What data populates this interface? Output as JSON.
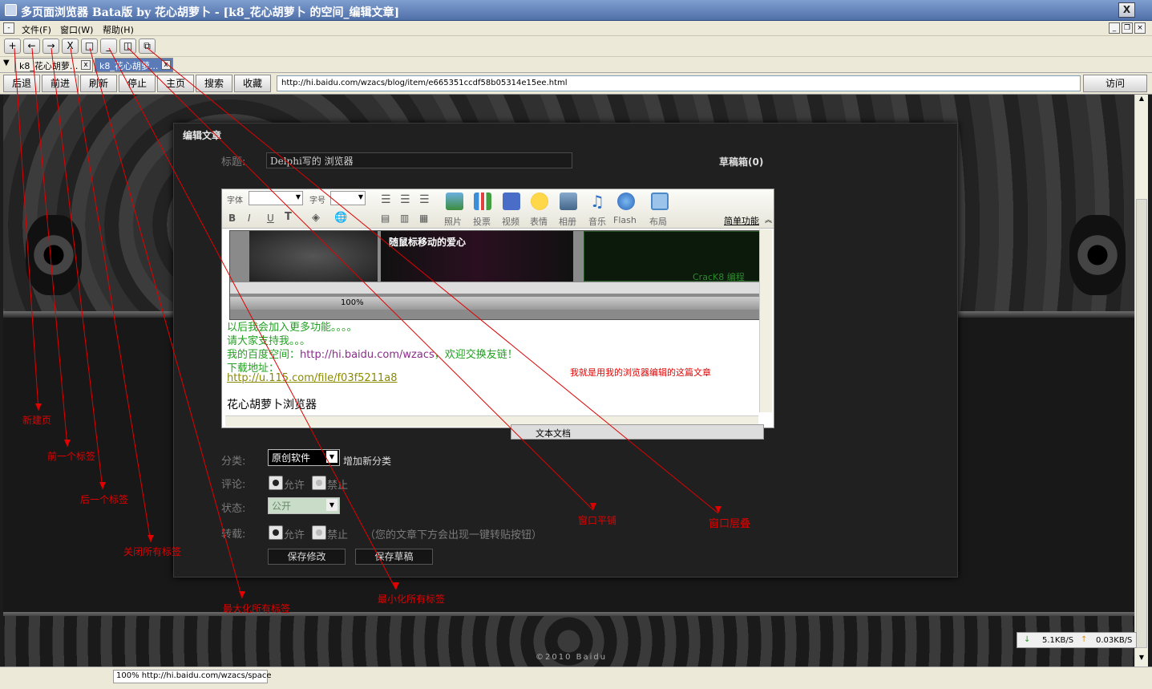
{
  "window": {
    "title": "多页面浏览器 Bata版 by 花心胡萝卜 - [k8_花心胡萝卜 的空间_编辑文章]",
    "close": "X"
  },
  "menu": {
    "items": [
      "文件(F)",
      "窗口(W)",
      "帮助(H)"
    ],
    "sys": "-"
  },
  "toolbar": {
    "buttons": [
      "+",
      "←",
      "→",
      "X",
      "□",
      "_"
    ]
  },
  "tabs": [
    {
      "label": "k8_花心胡萝..."
    },
    {
      "label": "k8_花心胡萝..."
    }
  ],
  "tab_close": "x",
  "nav": {
    "buttons": [
      "后退",
      "前进",
      "刷新",
      "停止",
      "主页",
      "搜索",
      "收藏"
    ],
    "url": "http://hi.baidu.com/wzacs/blog/item/e665351ccdf58b05314e15ee.html",
    "go": "访问"
  },
  "editor": {
    "header": "编辑文章",
    "title_label": "标题:",
    "title_value": "Delphi写的 浏览器",
    "drafts": "草稿箱(0)",
    "font_label": "字体",
    "size_label": "字号",
    "fmt": [
      "B",
      "I",
      "U",
      "T"
    ],
    "insert": [
      "照片",
      "投票",
      "视频",
      "表情",
      "相册",
      "音乐",
      "Flash",
      "布局"
    ],
    "simple": "简单功能",
    "inner_caption": "随鼠标移动的爱心",
    "inner_zoom": "100%",
    "inner_crack": "CracK8 编程",
    "lines": [
      "以后我会加入更多功能。。。。",
      "请大家支持我。。。"
    ],
    "space_label": "我的百度空间：",
    "space_link": "http://hi.baidu.com/wzacs",
    "space_tail": "，欢迎交换友链！",
    "download_label": "下载地址：",
    "download_link": "http://u.115.com/file/f03f5211a8",
    "signature": "花心胡萝卜浏览器",
    "doc_popup": "文本文档",
    "category_label": "分类:",
    "category_value": "原创软件",
    "add_category": "增加新分类",
    "comment_label": "评论:",
    "allow": "允许",
    "forbid": "禁止",
    "status_label": "状态:",
    "status_value": "公开",
    "repost_label": "转载:",
    "repost_hint": "（您的文章下方会出现一键转贴按钮）",
    "save": "保存修改",
    "save_draft": "保存草稿"
  },
  "annotations": {
    "new_page": "新建页",
    "prev_tab": "前一个标签",
    "next_tab": "后一个标签",
    "close_all": "关闭所有标签",
    "maximize_all": "最大化所有标签",
    "minimize_all": "最小化所有标签",
    "tile": "窗口平铺",
    "cascade": "窗口层叠",
    "edited_with": "我就是用我的浏览器编辑的这篇文章"
  },
  "footer": {
    "copyright": "©2010 Baidu"
  },
  "status": {
    "zoom": "100%",
    "url": "http://hi.baidu.com/wzacs/space",
    "down": "5.1KB/S",
    "up": "0.03KB/S"
  },
  "colors": {
    "annotation": "#e00000",
    "link": "#8a2c8a",
    "green_text": "#22a022"
  }
}
